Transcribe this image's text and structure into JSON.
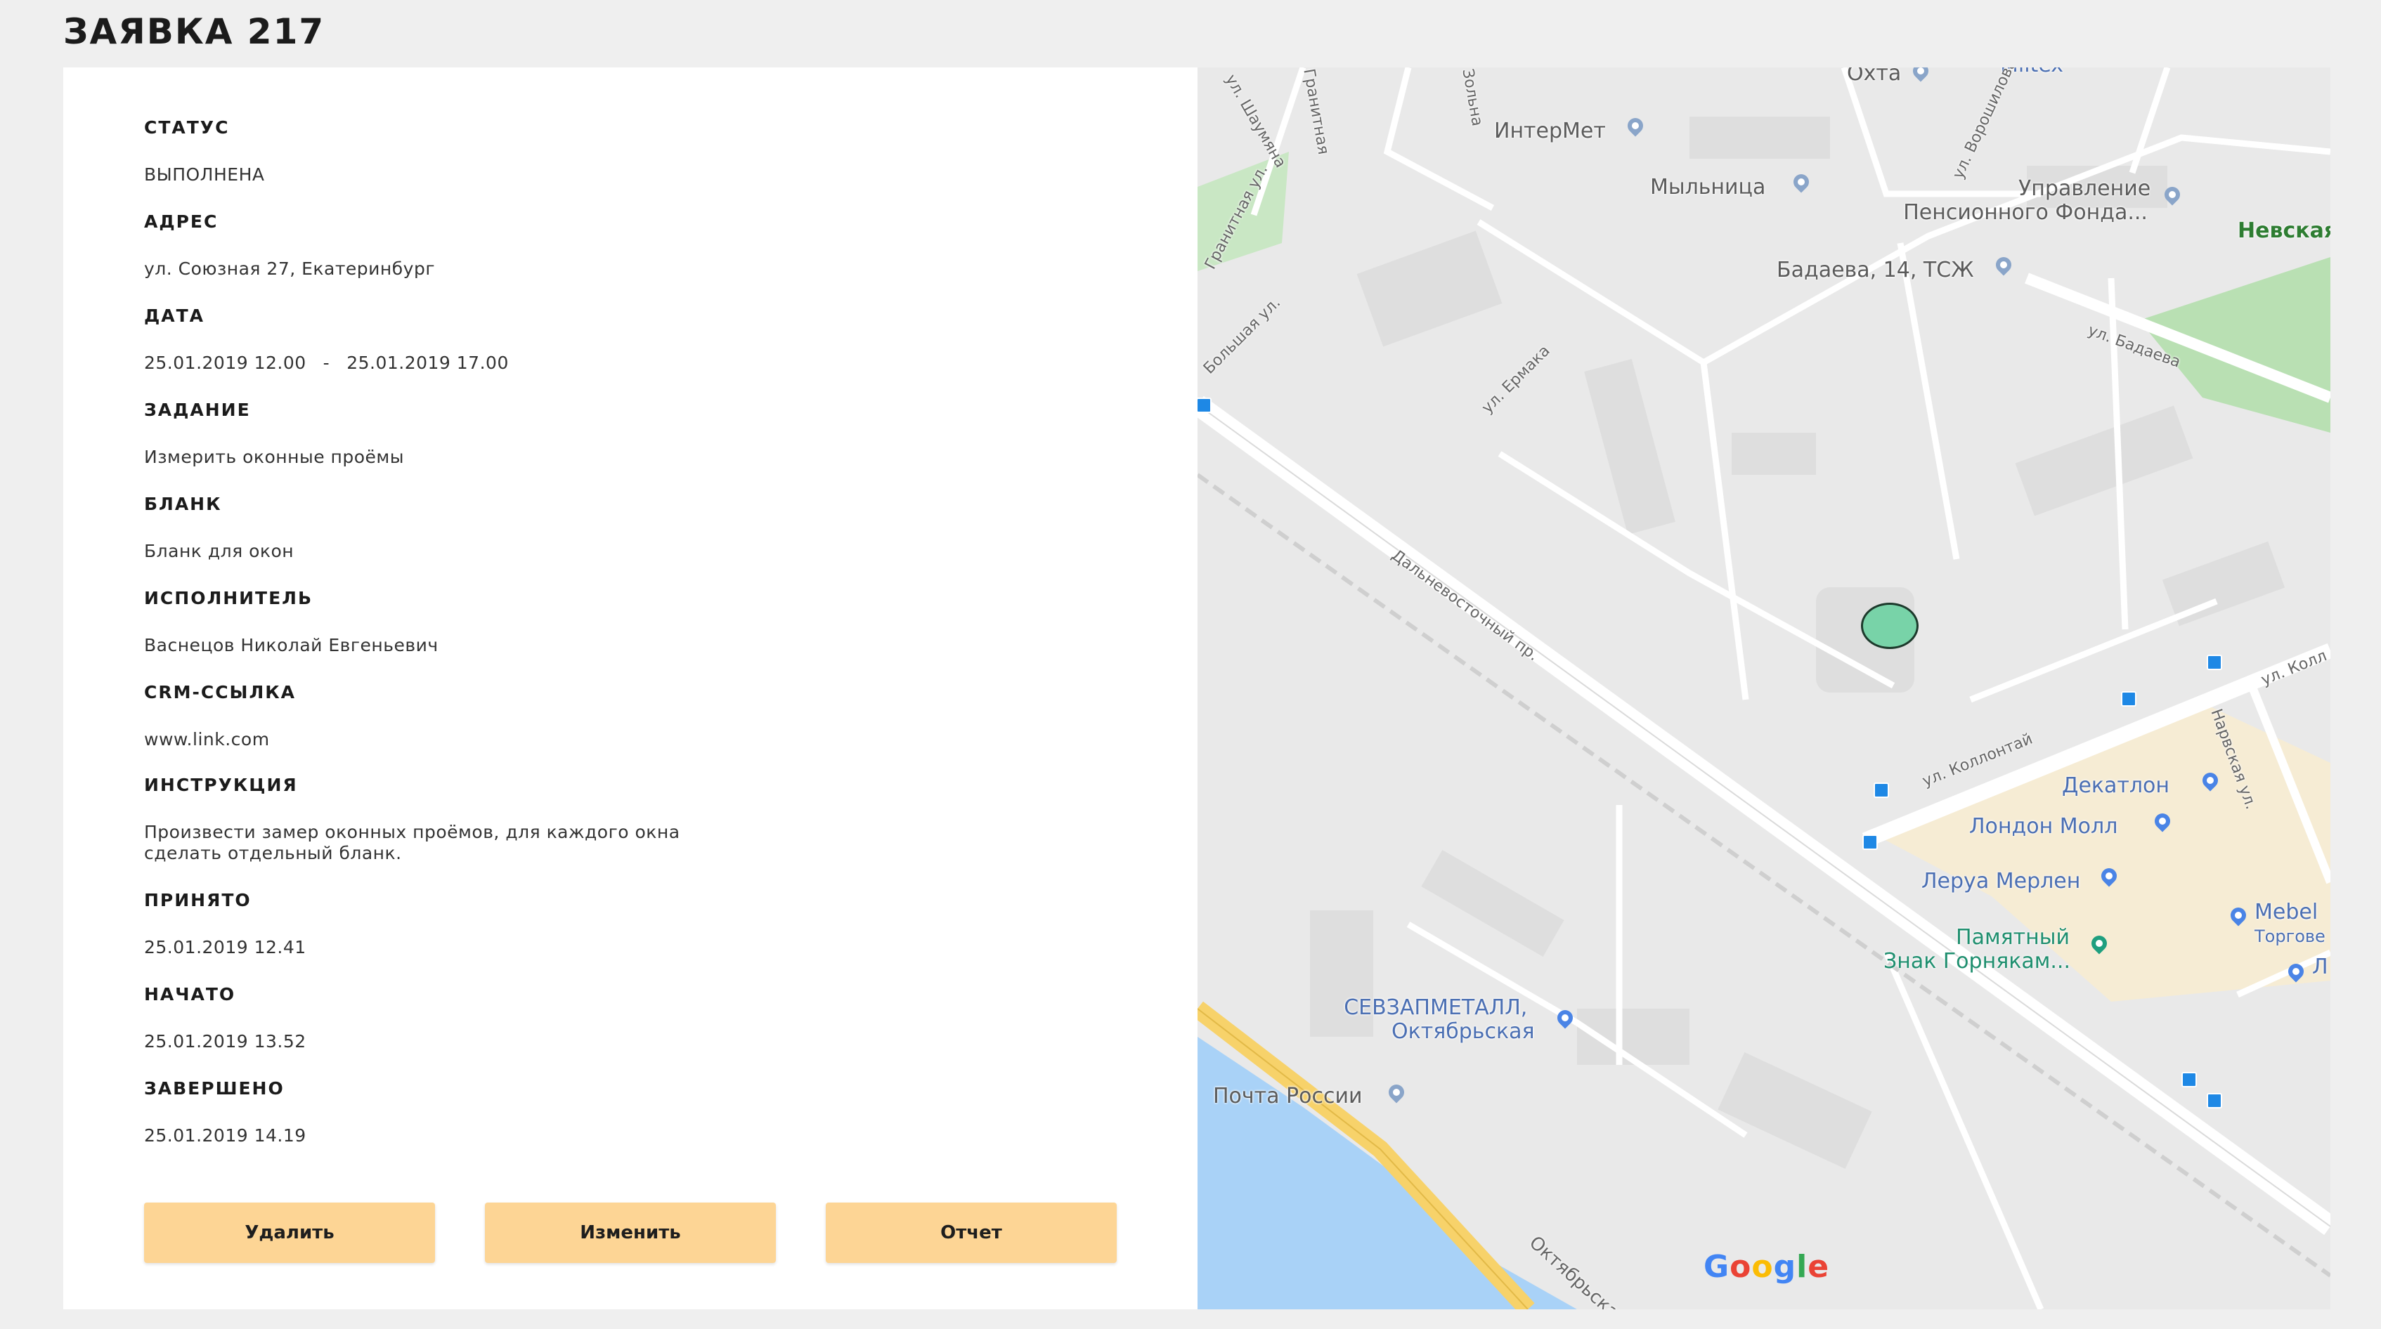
{
  "page": {
    "title": "ЗАЯВКА 217"
  },
  "details": {
    "status": {
      "label": "СТАТУС",
      "value": "ВЫПОЛНЕНА"
    },
    "address": {
      "label": "АДРЕС",
      "value": "ул. Союзная 27, Екатеринбург"
    },
    "date": {
      "label": "ДАТА",
      "from": "25.01.2019 12.00",
      "separator": "-",
      "to": "25.01.2019 17.00"
    },
    "task": {
      "label": "ЗАДАНИЕ",
      "value": "Измерить оконные проёмы"
    },
    "form": {
      "label": "БЛАНК",
      "value": "Бланк для окон"
    },
    "executor": {
      "label": "ИСПОЛНИТЕЛЬ",
      "value": "Васнецов Николай Евгеньевич"
    },
    "crm": {
      "label": "CRM-ССЫЛКА",
      "value": "www.link.com"
    },
    "instruction": {
      "label": "ИНСТРУКЦИЯ",
      "value": "Произвести замер оконных проёмов, для каждого окна сделать отдельный бланк."
    },
    "accepted": {
      "label": "ПРИНЯТО",
      "value": "25.01.2019 12.41"
    },
    "started": {
      "label": "НАЧАТО",
      "value": "25.01.2019 13.52"
    },
    "completed": {
      "label": "ЗАВЕРШЕНО",
      "value": "25.01.2019 14.19"
    }
  },
  "actions": {
    "delete_label": "Удалить",
    "edit_label": "Изменить",
    "report_label": "Отчет"
  },
  "map": {
    "marker_color": "#78d3a8",
    "places": {
      "okhta": "Охта",
      "miltex": "Miltex",
      "intermet": "ИнтерМет",
      "mylnitsa": "Мыльница",
      "pension_1": "Управление",
      "pension_2": "Пенсионного Фонда...",
      "nevskaya": "Невская",
      "badaeva": "Бадаева, 14, ТСЖ",
      "decathlon": "Декатлон",
      "london_mall": "Лондон Молл",
      "leroy": "Леруа Мерлен",
      "memorial_1": "Памятный",
      "memorial_2": "Знак Горнякам...",
      "mebel_1": "Mebel",
      "mebel_2": "Торгове",
      "sevzap_1": "СЕВЗАПМЕТАЛЛ,",
      "sevzap_2": "Октябрьская",
      "post": "Почта России",
      "l_short": "Л"
    },
    "streets": {
      "shaumyana": "ул. Шаумяна",
      "granitnaya": "Гранитная",
      "zolnaya": "Зольна",
      "voroshilova": "ул. Ворошилова",
      "granitnaya_ul": "Гранитная ул.",
      "bolshaya": "Большая ул.",
      "ermaka": "ул. Ермака",
      "dalnevostochny": "Дальневосточный пр.",
      "kollontai_1": "ул. Коллонтай",
      "kollontai_2": "ул. Колл",
      "badaeva": "ул. Бадаева",
      "narvskaya": "Нарвская ул.",
      "oktyabrskaya": "Октябрьская"
    },
    "logo": [
      "G",
      "o",
      "o",
      "g",
      "l",
      "e"
    ]
  }
}
